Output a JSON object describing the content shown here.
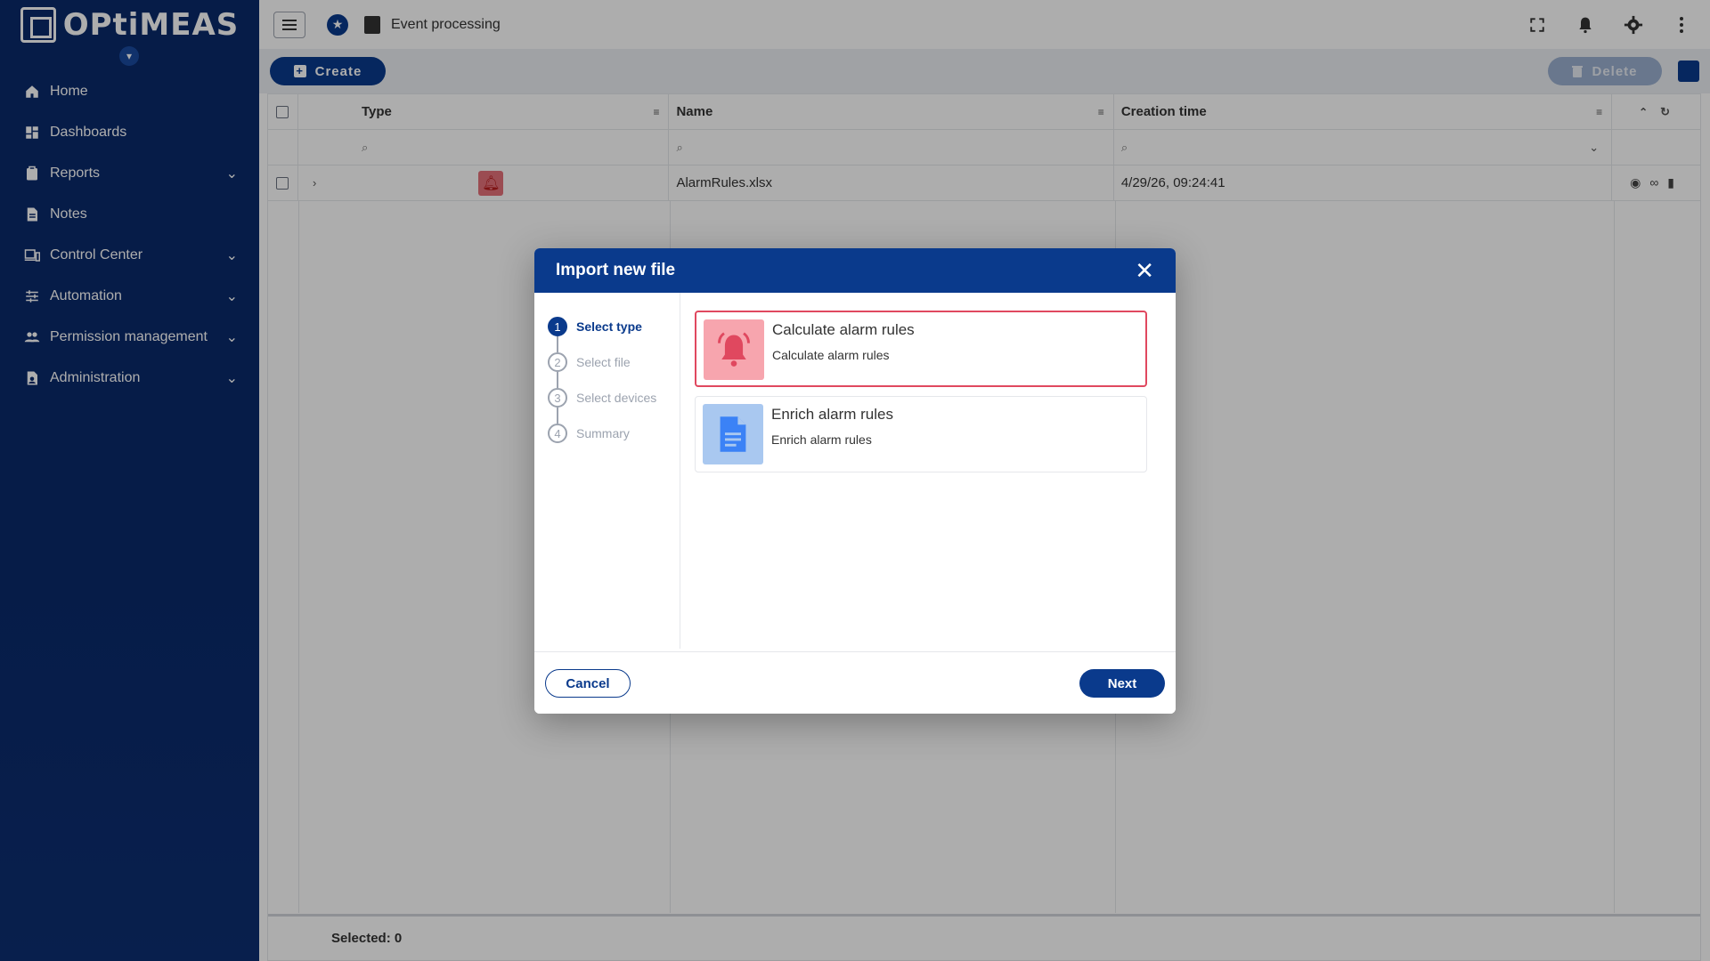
{
  "app": {
    "brand": "OPtiMEAS"
  },
  "sidebar": {
    "items": [
      {
        "label": "Home",
        "icon": "home-icon",
        "expandable": false
      },
      {
        "label": "Dashboards",
        "icon": "dashboard-icon",
        "expandable": false
      },
      {
        "label": "Reports",
        "icon": "clipboard-icon",
        "expandable": true
      },
      {
        "label": "Notes",
        "icon": "note-icon",
        "expandable": false
      },
      {
        "label": "Control Center",
        "icon": "devices-icon",
        "expandable": true
      },
      {
        "label": "Automation",
        "icon": "tune-icon",
        "expandable": true
      },
      {
        "label": "Permission management",
        "icon": "people-icon",
        "expandable": true
      },
      {
        "label": "Administration",
        "icon": "admin-icon",
        "expandable": true
      }
    ]
  },
  "header": {
    "title": "Event processing"
  },
  "toolbar": {
    "create_label": "Create",
    "delete_label": "Delete"
  },
  "table": {
    "columns": {
      "type": "Type",
      "name": "Name",
      "created": "Creation time"
    },
    "rows": [
      {
        "type_icon": "bell-icon",
        "name": "AlarmRules.xlsx",
        "created": "4/29/26, 09:24:41"
      }
    ],
    "footer": "Selected: 0"
  },
  "dialog": {
    "title": "Import new file",
    "steps": [
      {
        "num": "1",
        "label": "Select type",
        "active": true
      },
      {
        "num": "2",
        "label": "Select file",
        "active": false
      },
      {
        "num": "3",
        "label": "Select devices",
        "active": false
      },
      {
        "num": "4",
        "label": "Summary",
        "active": false
      }
    ],
    "options": [
      {
        "title": "Calculate alarm rules",
        "subtitle": "Calculate alarm rules",
        "icon": "bell-icon",
        "selected": true
      },
      {
        "title": "Enrich alarm rules",
        "subtitle": "Enrich alarm rules",
        "icon": "document-icon",
        "selected": false
      }
    ],
    "cancel_label": "Cancel",
    "next_label": "Next"
  },
  "colors": {
    "primary": "#0a3a8c",
    "selected_border": "#e0485f",
    "sidebar_bg": "#0a2a6b"
  }
}
